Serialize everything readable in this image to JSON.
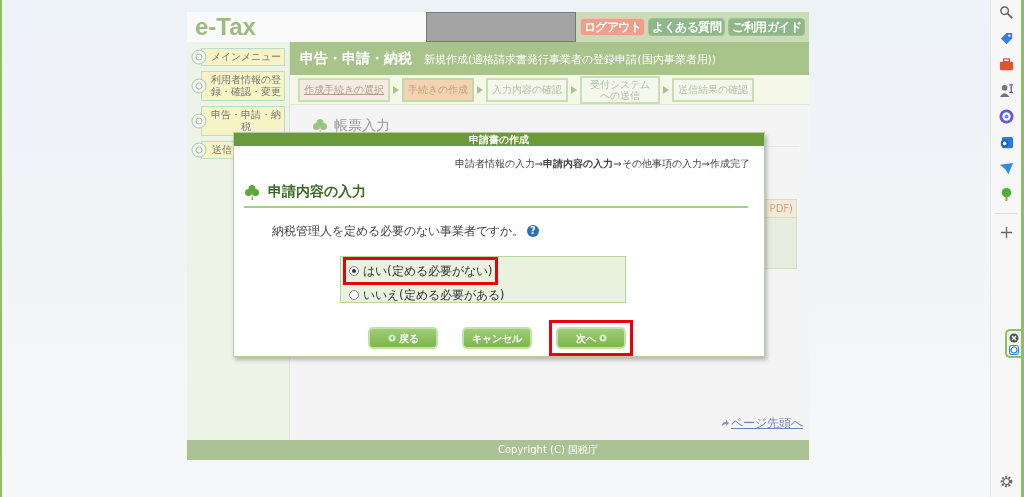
{
  "header": {
    "logo": "e-Tax",
    "buttons": [
      {
        "label": "ログアウト",
        "kind": "logout"
      },
      {
        "label": "よくある質問",
        "kind": "nav"
      },
      {
        "label": "ご利用ガイド",
        "kind": "nav"
      }
    ]
  },
  "sidebar": {
    "items": [
      {
        "label": "メインメニュー"
      },
      {
        "label": "利用者情報の登録・確認・変更"
      },
      {
        "label": "申告・申請・納税"
      },
      {
        "label": "送信"
      }
    ]
  },
  "page_title": "申告・申請・納税",
  "page_subtitle": "新規作成(適格請求書発行事業者の登録申請(国内事業者用))",
  "steps": [
    {
      "label": "作成手続きの選択",
      "kind": "link",
      "selected": false
    },
    {
      "label": "手続きの作成",
      "kind": "plain",
      "selected": true
    },
    {
      "label": "入力内容の確認",
      "kind": "plain",
      "selected": false
    },
    {
      "label": "受付システムへの送信",
      "kind": "plain",
      "selected": false
    },
    {
      "label": "送信結果の確認",
      "kind": "plain",
      "selected": false
    }
  ],
  "section_heading": "帳票入力",
  "table_header_fragment": "PDF)",
  "page_top_link": "ページ先頭へ",
  "footer": "Copyright (C) 国税庁",
  "dialog": {
    "title": "申請書の作成",
    "breadcrumb": "申請者情報の入力⇒**申請内容の入力**⇒その他事項の入力⇒作成完了",
    "heading": "申請内容の入力",
    "question": "納税管理人を定める必要のない事業者ですか。",
    "help_icon": "?",
    "options": [
      {
        "label": "はい(定める必要がない)",
        "selected": true,
        "highlighted": true
      },
      {
        "label": "いいえ(定める必要がある)",
        "selected": false,
        "highlighted": false
      }
    ],
    "buttons": [
      {
        "label": "戻る",
        "kind": "back",
        "highlighted": false
      },
      {
        "label": "キャンセル",
        "kind": "plain",
        "highlighted": false
      },
      {
        "label": "次へ",
        "kind": "next",
        "highlighted": true
      }
    ]
  }
}
